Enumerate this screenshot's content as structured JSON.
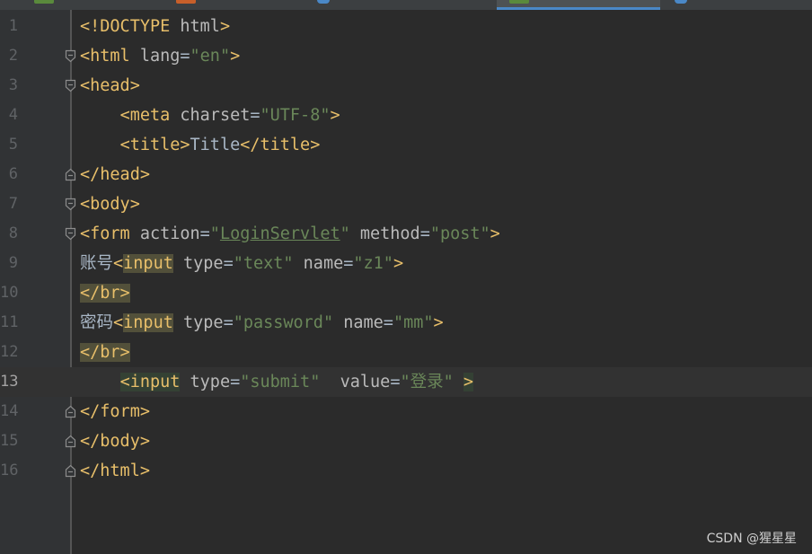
{
  "editor": {
    "language": "html",
    "current_line": 13,
    "lines": [
      {
        "num": "1",
        "tokens": [
          {
            "t": "<!DOCTYPE ",
            "c": "tg"
          },
          {
            "t": "html",
            "c": "at"
          },
          {
            "t": ">",
            "c": "tg"
          }
        ]
      },
      {
        "num": "2",
        "fold": "open",
        "tokens": [
          {
            "t": "<html ",
            "c": "tg"
          },
          {
            "t": "lang",
            "c": "at"
          },
          {
            "t": "=",
            "c": "df"
          },
          {
            "t": "\"en\"",
            "c": "vl"
          },
          {
            "t": ">",
            "c": "tg"
          }
        ]
      },
      {
        "num": "3",
        "fold": "open",
        "tokens": [
          {
            "t": "<head>",
            "c": "tg"
          }
        ]
      },
      {
        "num": "4",
        "tokens": [
          {
            "t": "    ",
            "c": "df"
          },
          {
            "t": "<meta ",
            "c": "tg"
          },
          {
            "t": "charset",
            "c": "at"
          },
          {
            "t": "=",
            "c": "df"
          },
          {
            "t": "\"UTF-8\"",
            "c": "vl"
          },
          {
            "t": ">",
            "c": "tg"
          }
        ]
      },
      {
        "num": "5",
        "tokens": [
          {
            "t": "    ",
            "c": "df"
          },
          {
            "t": "<title>",
            "c": "tg"
          },
          {
            "t": "Title",
            "c": "df"
          },
          {
            "t": "</title>",
            "c": "tg"
          }
        ]
      },
      {
        "num": "6",
        "fold": "close",
        "tokens": [
          {
            "t": "</head>",
            "c": "tg"
          }
        ]
      },
      {
        "num": "7",
        "fold": "open",
        "tokens": [
          {
            "t": "<body>",
            "c": "tg"
          }
        ]
      },
      {
        "num": "8",
        "fold": "open",
        "tokens": [
          {
            "t": "<form ",
            "c": "tg"
          },
          {
            "t": "action",
            "c": "at"
          },
          {
            "t": "=",
            "c": "df"
          },
          {
            "t": "\"",
            "c": "vl"
          },
          {
            "t": "LoginServlet",
            "c": "vl url"
          },
          {
            "t": "\"",
            "c": "vl"
          },
          {
            "t": " method",
            "c": "at"
          },
          {
            "t": "=",
            "c": "df"
          },
          {
            "t": "\"post\"",
            "c": "vl"
          },
          {
            "t": ">",
            "c": "tg"
          }
        ]
      },
      {
        "num": "9",
        "tokens": [
          {
            "t": "账号",
            "c": "df"
          },
          {
            "t": "<",
            "c": "tg"
          },
          {
            "t": "input",
            "c": "tg hl-y"
          },
          {
            "t": " type",
            "c": "at"
          },
          {
            "t": "=",
            "c": "df"
          },
          {
            "t": "\"text\"",
            "c": "vl"
          },
          {
            "t": " name",
            "c": "at"
          },
          {
            "t": "=",
            "c": "df"
          },
          {
            "t": "\"z1\"",
            "c": "vl"
          },
          {
            "t": ">",
            "c": "tg"
          }
        ]
      },
      {
        "num": "10",
        "tokens": [
          {
            "t": "</br>",
            "c": "tg hl-y"
          }
        ]
      },
      {
        "num": "11",
        "tokens": [
          {
            "t": "密码",
            "c": "df"
          },
          {
            "t": "<",
            "c": "tg"
          },
          {
            "t": "input",
            "c": "tg hl-y"
          },
          {
            "t": " type",
            "c": "at"
          },
          {
            "t": "=",
            "c": "df"
          },
          {
            "t": "\"password\"",
            "c": "vl"
          },
          {
            "t": " name",
            "c": "at"
          },
          {
            "t": "=",
            "c": "df"
          },
          {
            "t": "\"mm\"",
            "c": "vl"
          },
          {
            "t": ">",
            "c": "tg"
          }
        ]
      },
      {
        "num": "12",
        "tokens": [
          {
            "t": "</br>",
            "c": "tg hl-y"
          }
        ]
      },
      {
        "num": "13",
        "tokens": [
          {
            "t": "    ",
            "c": "df"
          },
          {
            "t": "<input",
            "c": "tg hl-c"
          },
          {
            "t": " type",
            "c": "at"
          },
          {
            "t": "=",
            "c": "df"
          },
          {
            "t": "\"submit\"",
            "c": "vl"
          },
          {
            "t": "  value",
            "c": "at"
          },
          {
            "t": "=",
            "c": "df"
          },
          {
            "t": "\"登录\"",
            "c": "vl"
          },
          {
            "t": " ",
            "c": "df"
          },
          {
            "t": ">",
            "c": "tg hl-c"
          }
        ]
      },
      {
        "num": "14",
        "fold": "close",
        "tokens": [
          {
            "t": "</form>",
            "c": "tg"
          }
        ]
      },
      {
        "num": "15",
        "fold": "close",
        "tokens": [
          {
            "t": "</body>",
            "c": "tg"
          }
        ]
      },
      {
        "num": "16",
        "fold": "close",
        "tokens": [
          {
            "t": "</html>",
            "c": "tg"
          }
        ]
      }
    ]
  },
  "tabs": [
    {
      "icon_color": "#5a8a3c",
      "active": false
    },
    {
      "icon_color": "#c75f2a",
      "active": false
    },
    {
      "icon_color": "#4a88c7",
      "active": false
    },
    {
      "icon_color": "#5a8a3c",
      "active": true
    },
    {
      "icon_color": "#4a88c7",
      "active": false
    }
  ],
  "watermark": "CSDN @猩星星"
}
